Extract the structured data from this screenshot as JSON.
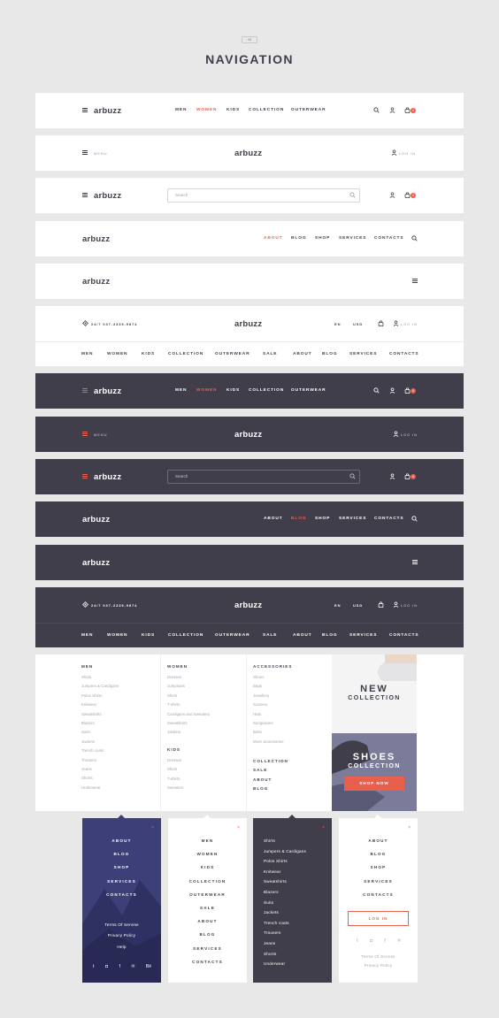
{
  "header": {
    "badge": "08",
    "title": "NAVIGATION"
  },
  "brand": "arbuzz",
  "nav_short": [
    "MEN",
    "WOMEN",
    "KIDS",
    "COLLECTION",
    "OUTERWEAR"
  ],
  "nav_info": [
    "ABOUT",
    "BLOG",
    "SHOP",
    "SERVICES",
    "CONTACTS"
  ],
  "nav_full": [
    "MEN",
    "WOMEN",
    "KIDS",
    "COLLECTION",
    "OUTERWEAR",
    "SALE",
    "ABOUT",
    "BLOG",
    "SERVICES",
    "CONTACTS"
  ],
  "menu_label": "MENU",
  "login_label": "LOG IN",
  "search_placeholder": "Search",
  "cart_count": "0",
  "phone": "24/7  037-2339-9874",
  "lang": "EN",
  "currency": "USD",
  "mega": {
    "men_title": "MEN",
    "men_items": [
      "Shirts",
      "Jumpers & Cardigans",
      "Polos Shirts",
      "Knitwear",
      "Sweatshirts",
      "Blazers",
      "Suits",
      "Jackets",
      "Trench coats",
      "Trousers",
      "Jeans",
      "Shorts",
      "Underwear"
    ],
    "women_title": "WOMEN",
    "women_items": [
      "Dresses",
      "Jumpsuits",
      "Shirts",
      "T-shirts",
      "Cardigans and Sweaters",
      "Sweatshirts",
      "Jackets"
    ],
    "kids_title": "KIDS",
    "kids_items": [
      "Dresses",
      "Shirts",
      "T-shirts",
      "Sweaters"
    ],
    "acc_title": "ACCESSORIES",
    "acc_items": [
      "Shoes",
      "Bags",
      "Jewellery",
      "Scarves",
      "Hats",
      "Sunglasses",
      "Belts",
      "More accessories"
    ],
    "extra": [
      "COLLECTION",
      "SALE",
      "ABOUT",
      "BLOG"
    ],
    "promo1_a": "NEW",
    "promo1_b": "COLLECTION",
    "promo2_a": "SHOES",
    "promo2_b": "COLLECTION",
    "promo2_button": "SHOP NOW"
  },
  "panel1": {
    "items": [
      "ABOUT",
      "BLOG",
      "SHOP",
      "SERVICES",
      "CONTACTS"
    ],
    "links": [
      "Terms Of Servise",
      "Privacy Policy",
      "Help"
    ]
  },
  "panel2": {
    "items": [
      "MEN",
      "WOMEN",
      "KIDS",
      "COLLECTION",
      "OUTERWEAR",
      "SALE",
      "ABOUT",
      "BLOG",
      "SERVICES",
      "CONTACTS"
    ]
  },
  "panel3": {
    "items": [
      "Shirts",
      "Jumpers & Cardigans",
      "Polos Shirts",
      "Knitwear",
      "Sweatshirts",
      "Blazers",
      "Suits",
      "Jackets",
      "Trench coats",
      "Trousers",
      "Jeans",
      "Shorts",
      "Underwear"
    ]
  },
  "panel4": {
    "items": [
      "ABOUT",
      "BLOG",
      "SHOP",
      "SERVICES",
      "CONTACTS"
    ],
    "login": "LOG IN",
    "links": [
      "Terms Of Servise",
      "Privacy Policy"
    ]
  },
  "colors": {
    "accent": "#e8604c",
    "dark": "#3f3e4a",
    "bg": "#e8e8e9",
    "promo": "#7b7b9a"
  }
}
